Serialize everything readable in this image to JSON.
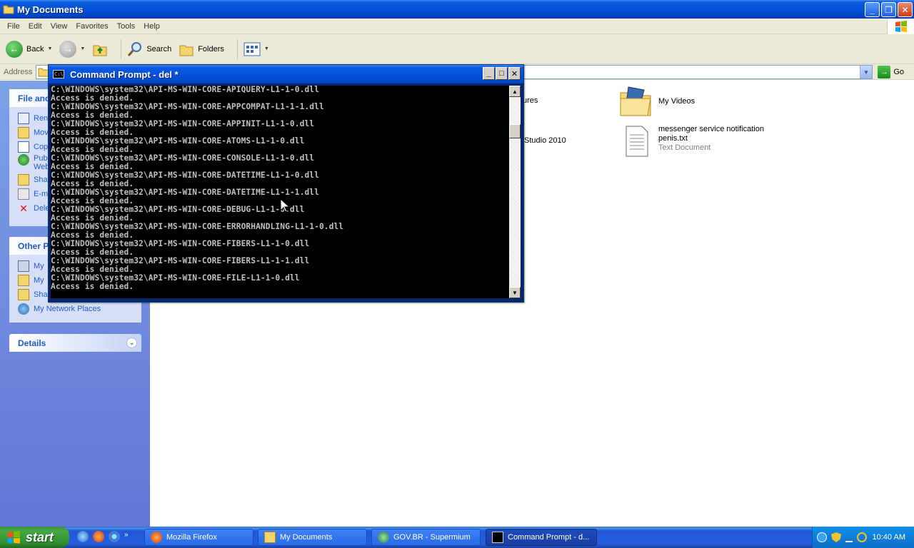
{
  "explorer": {
    "title": "My Documents",
    "menus": [
      "File",
      "Edit",
      "View",
      "Favorites",
      "Tools",
      "Help"
    ],
    "toolbar": {
      "back": "Back",
      "search": "Search",
      "folders": "Folders"
    },
    "address": {
      "label": "Address",
      "go": "Go"
    },
    "sidebar": {
      "file_tasks": {
        "title": "File and",
        "items": [
          "Ren",
          "Mov",
          "Cop",
          "Pub",
          "Web",
          "Sha",
          "E-m",
          "Dele"
        ]
      },
      "other_places": {
        "title": "Other P",
        "items": [
          "My",
          "My",
          "Sha",
          "My Network Places"
        ]
      },
      "details": {
        "title": "Details"
      }
    },
    "files": [
      {
        "name": "ures",
        "type": ""
      },
      {
        "name": "Studio 2010",
        "type": ""
      },
      {
        "name": "My Videos",
        "type": ""
      },
      {
        "name_line1": "messenger service notification",
        "name_line2": "penis.txt",
        "type": "Text Document"
      }
    ]
  },
  "cmd": {
    "title": "Command Prompt - del *",
    "lines": [
      "C:\\WINDOWS\\system32\\API-MS-WIN-CORE-APIQUERY-L1-1-0.dll",
      "Access is denied.",
      "C:\\WINDOWS\\system32\\API-MS-WIN-CORE-APPCOMPAT-L1-1-1.dll",
      "Access is denied.",
      "C:\\WINDOWS\\system32\\API-MS-WIN-CORE-APPINIT-L1-1-0.dll",
      "Access is denied.",
      "C:\\WINDOWS\\system32\\API-MS-WIN-CORE-ATOMS-L1-1-0.dll",
      "Access is denied.",
      "C:\\WINDOWS\\system32\\API-MS-WIN-CORE-CONSOLE-L1-1-0.dll",
      "Access is denied.",
      "C:\\WINDOWS\\system32\\API-MS-WIN-CORE-DATETIME-L1-1-0.dll",
      "Access is denied.",
      "C:\\WINDOWS\\system32\\API-MS-WIN-CORE-DATETIME-L1-1-1.dll",
      "Access is denied.",
      "C:\\WINDOWS\\system32\\API-MS-WIN-CORE-DEBUG-L1-1-0.dll",
      "Access is denied.",
      "C:\\WINDOWS\\system32\\API-MS-WIN-CORE-ERRORHANDLING-L1-1-0.dll",
      "Access is denied.",
      "C:\\WINDOWS\\system32\\API-MS-WIN-CORE-FIBERS-L1-1-0.dll",
      "Access is denied.",
      "C:\\WINDOWS\\system32\\API-MS-WIN-CORE-FIBERS-L1-1-1.dll",
      "Access is denied.",
      "C:\\WINDOWS\\system32\\API-MS-WIN-CORE-FILE-L1-1-0.dll",
      "Access is denied."
    ]
  },
  "taskbar": {
    "start": "start",
    "tasks": [
      "Mozilla Firefox",
      "My Documents",
      "GOV.BR - Supermium",
      "Command Prompt - d..."
    ],
    "clock": "10:40 AM"
  },
  "colors": {
    "xp_blue": "#0450d9",
    "sidebar_link": "#215dc6",
    "console_text": "#c0c0c0",
    "start_green": "#3c8e3c"
  }
}
